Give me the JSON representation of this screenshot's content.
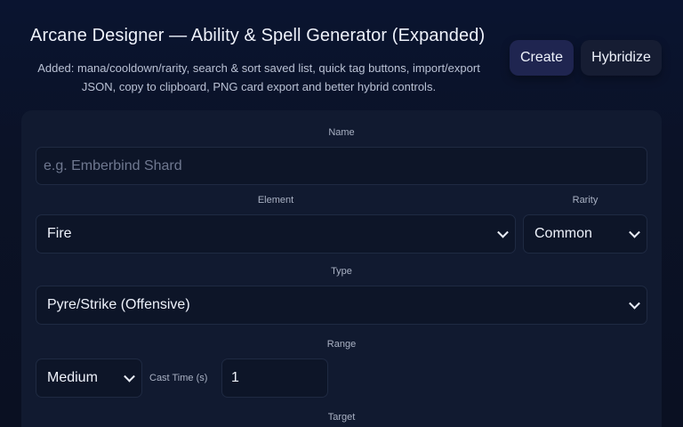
{
  "header": {
    "title": "Arcane Designer — Ability & Spell Generator (Expanded)",
    "subtitle": "Added: mana/cooldown/rarity, search & sort saved list, quick tag buttons, import/export JSON, copy to clipboard, PNG card export and better hybrid controls.",
    "create_label": "Create",
    "hybridize_label": "Hybridize"
  },
  "form": {
    "name_label": "Name",
    "name_placeholder": "e.g. Emberbind Shard",
    "element_label": "Element",
    "element_value": "Fire",
    "rarity_label": "Rarity",
    "rarity_value": "Common",
    "type_label": "Type",
    "type_value": "Pyre/Strike (Offensive)",
    "range_label": "Range",
    "range_value": "Medium",
    "cast_time_label": "Cast Time (s)",
    "cast_time_value": "1",
    "target_label": "Target"
  }
}
